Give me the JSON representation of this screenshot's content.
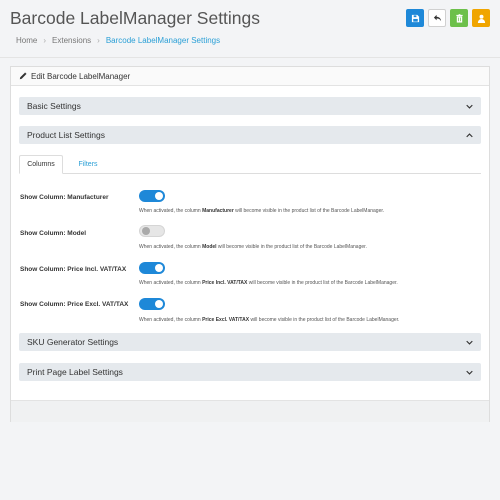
{
  "header": {
    "title": "Barcode LabelManager Settings",
    "breadcrumb": [
      "Home",
      "Extensions",
      "Barcode LabelManager Settings"
    ],
    "toolbar": {
      "save_icon": "save-icon",
      "back_icon": "back-arrow-icon",
      "clear_icon": "trash-icon",
      "user_icon": "user-icon"
    }
  },
  "card": {
    "title": "Edit Barcode LabelManager",
    "title_icon": "pencil-icon"
  },
  "sections": {
    "basic": "Basic Settings",
    "product_list": "Product List Settings",
    "sku": "SKU Generator Settings",
    "print": "Print Page Label Settings"
  },
  "tabs": [
    "Columns",
    "Filters"
  ],
  "settings": [
    {
      "label": "Show Column: Manufacturer",
      "enabled": true,
      "help_pre": "When activated, the column ",
      "help_bold": "Manufacturer",
      "help_post": " will become visible in the product list of the Barcode LabelManager."
    },
    {
      "label": "Show Column: Model",
      "enabled": false,
      "help_pre": "When activated, the column ",
      "help_bold": "Model",
      "help_post": " will become visible in the product list of the Barcode LabelManager."
    },
    {
      "label": "Show Column: Price Incl. VAT/TAX",
      "enabled": true,
      "help_pre": "When activated, the column ",
      "help_bold": "Price Incl. VAT/TAX",
      "help_post": " will become visible in the product list of the Barcode LabelManager."
    },
    {
      "label": "Show Column: Price Excl. VAT/TAX",
      "enabled": true,
      "help_pre": "When activated, the column ",
      "help_bold": "Price Excl. VAT/TAX",
      "help_post": " will become visible in the product list of the Barcode LabelManager."
    }
  ],
  "colors": {
    "primary": "#1e88d8",
    "success": "#6cc04a",
    "warning": "#f0a500",
    "link": "#2a9fd6"
  }
}
